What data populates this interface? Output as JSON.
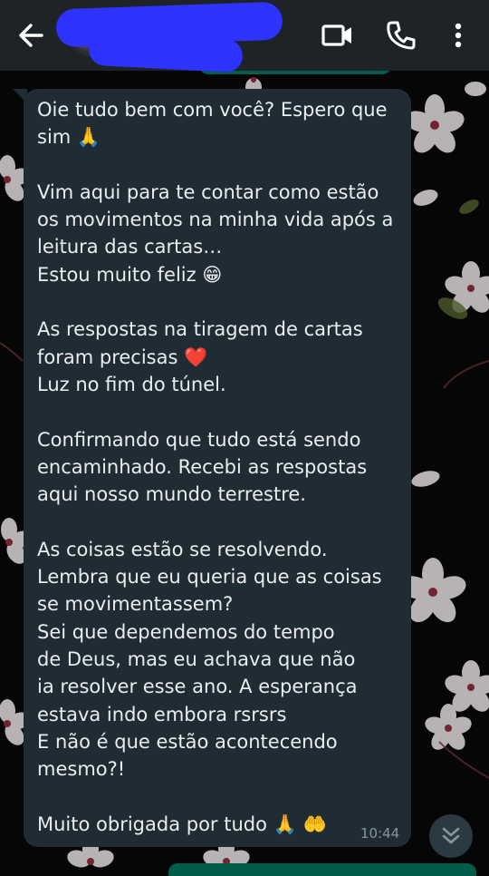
{
  "header": {
    "contact_name": "",
    "back_icon": "arrow-back-icon",
    "video_icon": "video-call-icon",
    "call_icon": "phone-icon",
    "menu_icon": "more-vert-icon"
  },
  "message": {
    "lines": [
      "Oie tudo bem com você? Espero que",
      "sim 🙏",
      "",
      "Vim aqui para te contar como estão",
      "os movimentos na minha vida após a",
      "leitura das cartas…",
      "Estou muito feliz 😁",
      "",
      "As respostas na tiragem de cartas",
      "foram precisas ❤️",
      "Luz no fim do túnel.",
      "",
      "Confirmando que tudo está sendo",
      "encaminhado. Recebi as respostas",
      "aqui nosso mundo terrestre.",
      "",
      "As coisas estão se resolvendo.",
      "Lembra que eu queria que as coisas",
      "se movimentassem?",
      "Sei que dependemos do tempo",
      "de Deus, mas eu achava que não",
      "ia resolver esse ano. A esperança",
      "estava indo embora rsrsrs",
      "E não é que estão acontecendo",
      "mesmo?!",
      "",
      "Muito obrigada por tudo 🙏 🤲"
    ],
    "time": "10:44"
  },
  "scroll_button": {
    "icon": "double-chevron-down-icon"
  },
  "colors": {
    "app_bar": "#1d2326",
    "bubble": "#1f2c34",
    "text": "#e9edef",
    "timestamp": "#8696a0",
    "outgoing_bubble": "#005c4b",
    "redaction": "#2f33ff"
  }
}
